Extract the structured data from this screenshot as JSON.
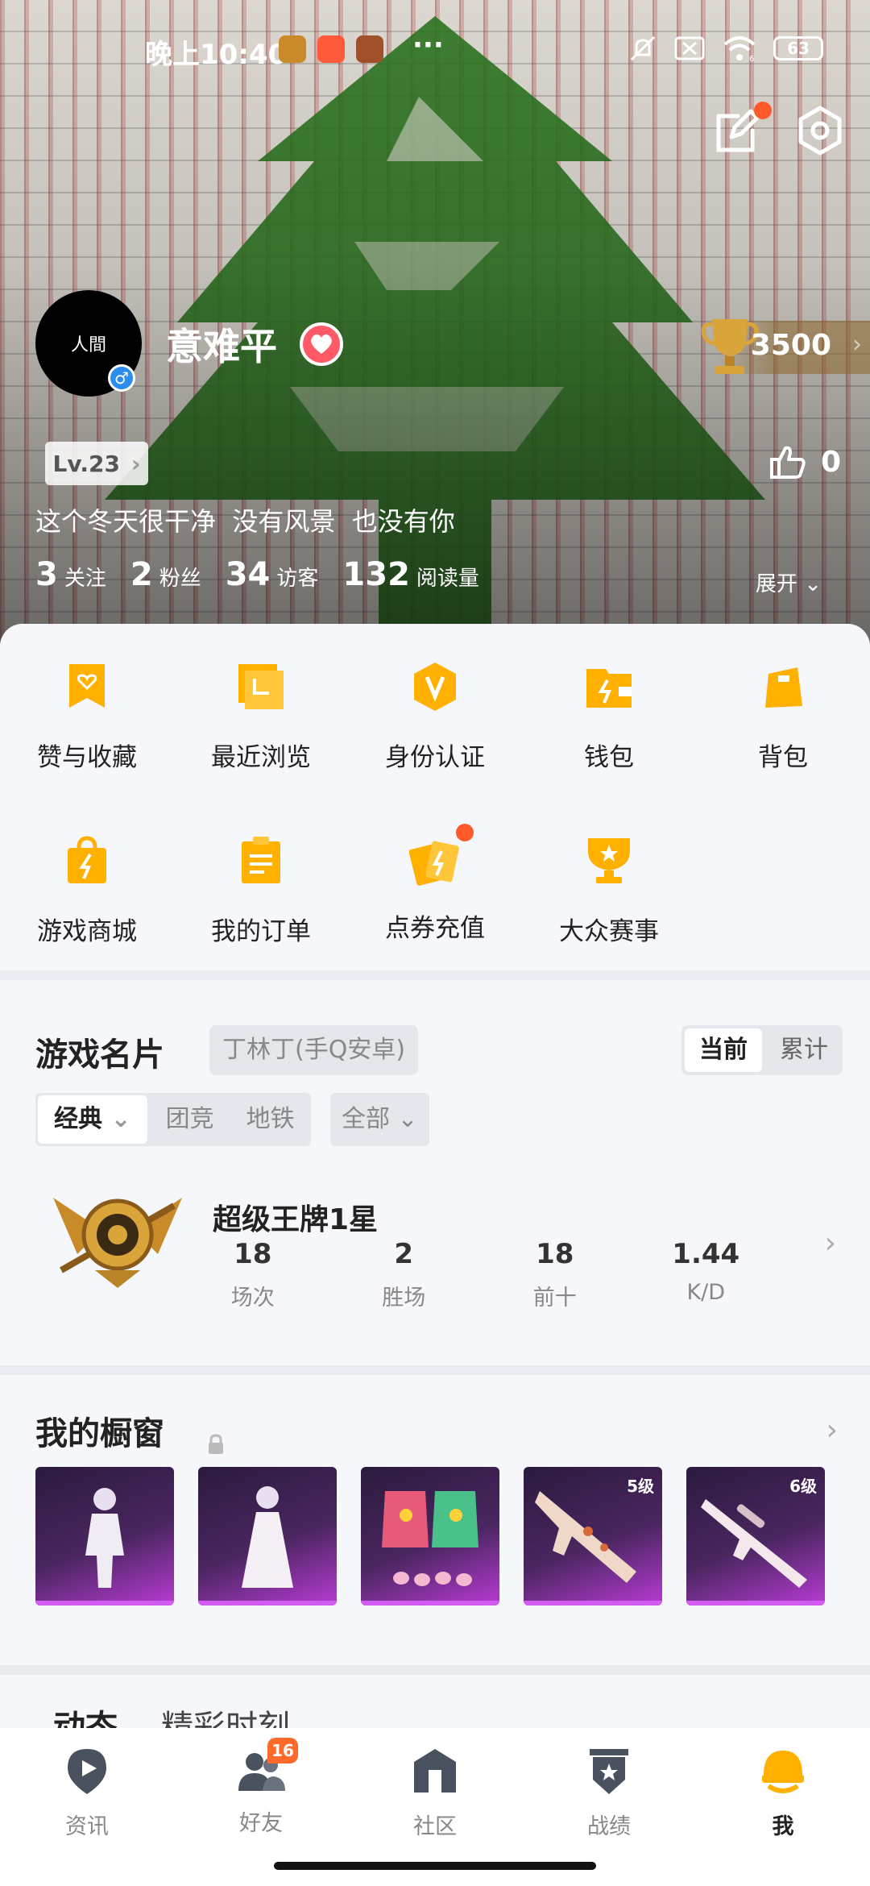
{
  "status_bar": {
    "time": "晚上10:40",
    "more": "···",
    "signal_sub": "6",
    "battery": "63"
  },
  "profile": {
    "avatar_text": "人間",
    "username": "意难平",
    "level": "Lv.23",
    "trophy_points": "3500",
    "likes": "0",
    "signature": "这个冬天很干净  没有风景  也没有你",
    "stats": [
      {
        "value": "3",
        "label": "关注"
      },
      {
        "value": "2",
        "label": "粉丝"
      },
      {
        "value": "34",
        "label": "访客"
      },
      {
        "value": "132",
        "label": "阅读量"
      }
    ],
    "expand_label": "展开"
  },
  "shortcuts": [
    {
      "label": "赞与收藏",
      "icon": "bookmark-heart-icon"
    },
    {
      "label": "最近浏览",
      "icon": "history-folder-icon"
    },
    {
      "label": "身份认证",
      "icon": "verified-shield-icon"
    },
    {
      "label": "钱包",
      "icon": "wallet-icon"
    },
    {
      "label": "背包",
      "icon": "backpack-icon"
    },
    {
      "label": "游戏商城",
      "icon": "shopping-bag-icon"
    },
    {
      "label": "我的订单",
      "icon": "clipboard-icon"
    },
    {
      "label": "点券充值",
      "icon": "voucher-cards-icon"
    },
    {
      "label": "大众赛事",
      "icon": "trophy-cup-icon"
    }
  ],
  "game_card": {
    "title": "游戏名片",
    "account": "丁林丁(手Q安卓)",
    "toggle": [
      "当前",
      "累计"
    ],
    "modes": [
      "经典",
      "团竞",
      "地铁"
    ],
    "filter": "全部",
    "rank_name": "超级王牌1星",
    "rank_stats": [
      {
        "value": "18",
        "label": "场次"
      },
      {
        "value": "2",
        "label": "胜场"
      },
      {
        "value": "18",
        "label": "前十"
      },
      {
        "value": "1.44",
        "label": "K/D"
      }
    ]
  },
  "showcase": {
    "title": "我的橱窗",
    "items": [
      {
        "level": ""
      },
      {
        "level": ""
      },
      {
        "level": ""
      },
      {
        "level": "5级"
      },
      {
        "level": "6级"
      }
    ]
  },
  "feed": {
    "tabs": [
      "动态",
      "精彩时刻"
    ]
  },
  "bottom_nav": [
    {
      "label": "资讯",
      "icon": "news-play-icon"
    },
    {
      "label": "好友",
      "icon": "friends-icon",
      "badge": "16"
    },
    {
      "label": "社区",
      "icon": "community-house-icon"
    },
    {
      "label": "战绩",
      "icon": "record-shield-icon"
    },
    {
      "label": "我",
      "icon": "helmet-profile-icon"
    }
  ],
  "colors": {
    "accent_orange": "#ffb000",
    "badge_red": "#ff5a2a",
    "showcase_purple": "#b83bd4"
  }
}
